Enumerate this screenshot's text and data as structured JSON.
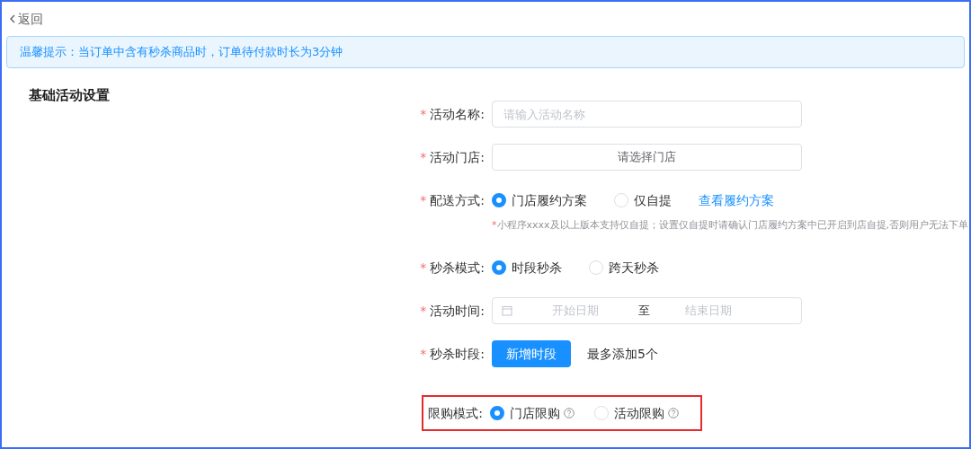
{
  "back": {
    "label": "返回"
  },
  "notice": {
    "text": "温馨提示：当订单中含有秒杀商品时，订单待付款时长为3分钟"
  },
  "section_title": "基础活动设置",
  "fields": [
    {
      "kind": "text",
      "required_mark": "*",
      "label": "活动名称:",
      "highlighted": false,
      "placeholder": "请输入活动名称"
    },
    {
      "kind": "select",
      "required_mark": "*",
      "label": "活动门店:",
      "highlighted": false,
      "placeholder": "请选择门店"
    },
    {
      "kind": "radio",
      "required_mark": "*",
      "label": "配送方式:",
      "highlighted": false,
      "options": [
        {
          "label": "门店履约方案",
          "selected": true,
          "help": false
        },
        {
          "label": "仅自提",
          "selected": false,
          "help": false
        }
      ],
      "link": "查看履约方案",
      "hint": {
        "mark": "*",
        "text": "小程序xxxx及以上版本支持仅自提；设置仅自提时请确认门店履约方案中已开启到店自提,否则用户无法下单"
      }
    },
    {
      "kind": "radio",
      "required_mark": "*",
      "label": "秒杀模式:",
      "highlighted": false,
      "options": [
        {
          "label": "时段秒杀",
          "selected": true,
          "help": false
        },
        {
          "label": "跨天秒杀",
          "selected": false,
          "help": false
        }
      ]
    },
    {
      "kind": "daterange",
      "required_mark": "*",
      "label": "活动时间:",
      "highlighted": false,
      "start_placeholder": "开始日期",
      "separator": "至",
      "end_placeholder": "结束日期"
    },
    {
      "kind": "button",
      "required_mark": "*",
      "label": "秒杀时段:",
      "highlighted": false,
      "button": "新增时段",
      "note": "最多添加5个"
    },
    {
      "kind": "radio",
      "label": "限购模式:",
      "highlighted": true,
      "options": [
        {
          "label": "门店限购",
          "selected": true,
          "help": true
        },
        {
          "label": "活动限购",
          "selected": false,
          "help": true
        }
      ]
    }
  ]
}
